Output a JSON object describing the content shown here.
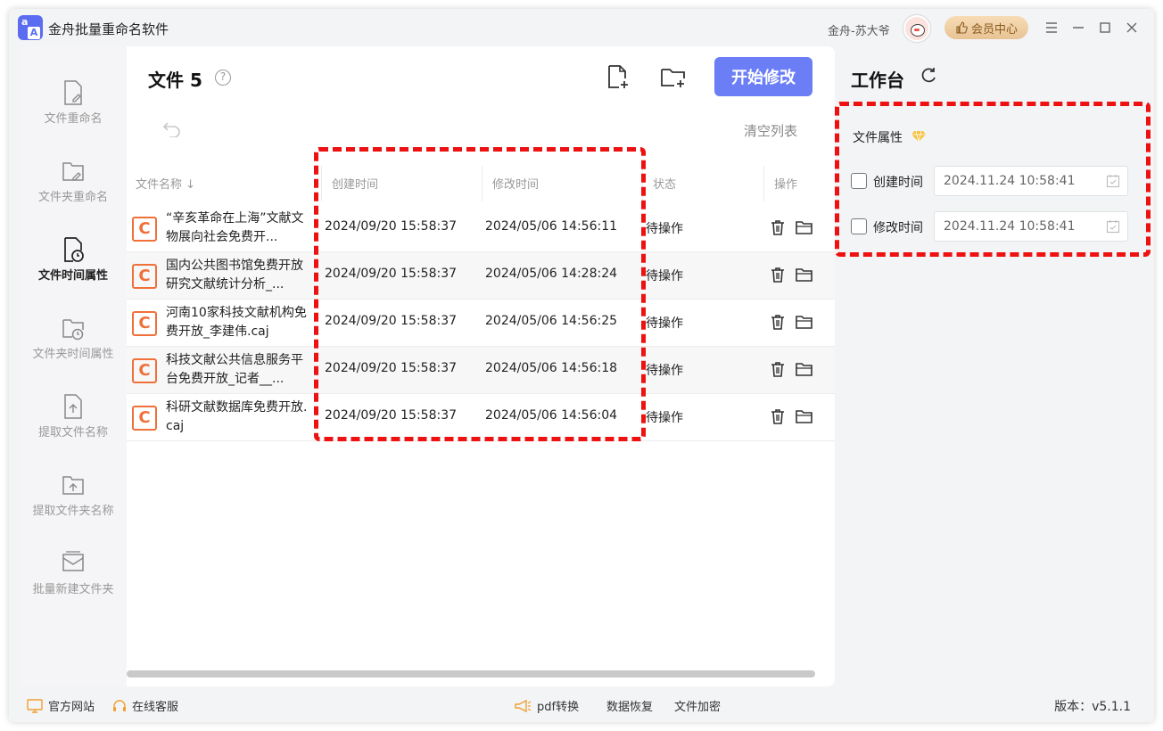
{
  "app": {
    "title": "金舟批量重命名软件",
    "logo_a": "a",
    "logo_b": "A"
  },
  "user": {
    "name": "金舟-苏大爷"
  },
  "vip_button": {
    "label": "会员中心"
  },
  "sidebar": {
    "items": [
      {
        "label": "文件重命名",
        "active": false
      },
      {
        "label": "文件夹重命名",
        "active": false
      },
      {
        "label": "文件时间属性",
        "active": true
      },
      {
        "label": "文件夹时间属性",
        "active": false
      },
      {
        "label": "提取文件名称",
        "active": false
      },
      {
        "label": "提取文件夹名称",
        "active": false
      },
      {
        "label": "批量新建文件夹",
        "active": false
      }
    ]
  },
  "main": {
    "title": "文件 5",
    "help": "?",
    "start_button": "开始修改",
    "clear_list": "清空列表",
    "columns": {
      "name": "文件名称",
      "created": "创建时间",
      "modified": "修改时间",
      "status": "状态",
      "actions": "操作"
    },
    "rows": [
      {
        "icon": "C",
        "name": "“辛亥革命在上海”文献文物展向社会免费开...",
        "created": "2024/09/20 15:58:37",
        "modified": "2024/05/06 14:56:11",
        "status": "待操作"
      },
      {
        "icon": "C",
        "name": "国内公共图书馆免费开放研究文献统计分析_...",
        "created": "2024/09/20 15:58:37",
        "modified": "2024/05/06 14:28:24",
        "status": "待操作"
      },
      {
        "icon": "C",
        "name": "河南10家科技文献机构免费开放_李建伟.caj",
        "created": "2024/09/20 15:58:37",
        "modified": "2024/05/06 14:56:25",
        "status": "待操作"
      },
      {
        "icon": "C",
        "name": "科技文献公共信息服务平台免费开放_记者__...",
        "created": "2024/09/20 15:58:37",
        "modified": "2024/05/06 14:56:18",
        "status": "待操作"
      },
      {
        "icon": "C",
        "name": "科研文献数据库免费开放.caj",
        "created": "2024/09/20 15:58:37",
        "modified": "2024/05/06 14:56:04",
        "status": "待操作"
      }
    ]
  },
  "workbench": {
    "title": "工作台",
    "attr_title": "文件属性",
    "fields": [
      {
        "label": "创建时间",
        "value": "2024.11.24 10:58:41",
        "checked": false
      },
      {
        "label": "修改时间",
        "value": "2024.11.24 10:58:41",
        "checked": false
      }
    ]
  },
  "footer": {
    "website": "官方网站",
    "support": "在线客服",
    "pdf": "pdf转换",
    "recovery": "数据恢复",
    "encrypt": "文件加密",
    "version": "版本：v5.1.1"
  },
  "colors": {
    "accent": "#6b7ef5",
    "highlight": "#ee1111",
    "file_icon": "#f0703a",
    "vip": "#e8c394"
  }
}
